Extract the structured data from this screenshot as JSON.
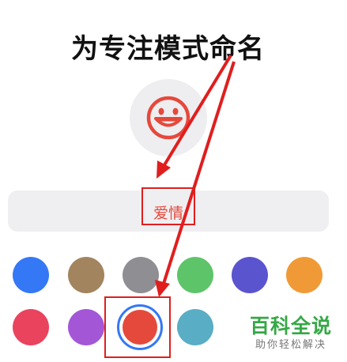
{
  "header": {
    "title": "为专注模式命名"
  },
  "icon": {
    "name": "smiley-face-icon",
    "color": "#e5493b"
  },
  "name_field": {
    "value": "爱情"
  },
  "colors": {
    "accent_selected_ring": "#3478f6",
    "annotation_red": "#e01e1e",
    "swatches": [
      {
        "name": "blue",
        "hex": "#3478f6"
      },
      {
        "name": "brown",
        "hex": "#a2845e"
      },
      {
        "name": "gray",
        "hex": "#8e8e93"
      },
      {
        "name": "green",
        "hex": "#5ec46a"
      },
      {
        "name": "indigo",
        "hex": "#5a54cf"
      },
      {
        "name": "orange",
        "hex": "#f09a37"
      },
      {
        "name": "pink-red",
        "hex": "#e9435e"
      },
      {
        "name": "purple",
        "hex": "#a357d7"
      },
      {
        "name": "red",
        "hex": "#e5493b",
        "selected": true
      },
      {
        "name": "teal",
        "hex": "#59adc4"
      }
    ]
  },
  "watermark": {
    "title": "百科全说",
    "subtitle": "助你轻松解决"
  }
}
